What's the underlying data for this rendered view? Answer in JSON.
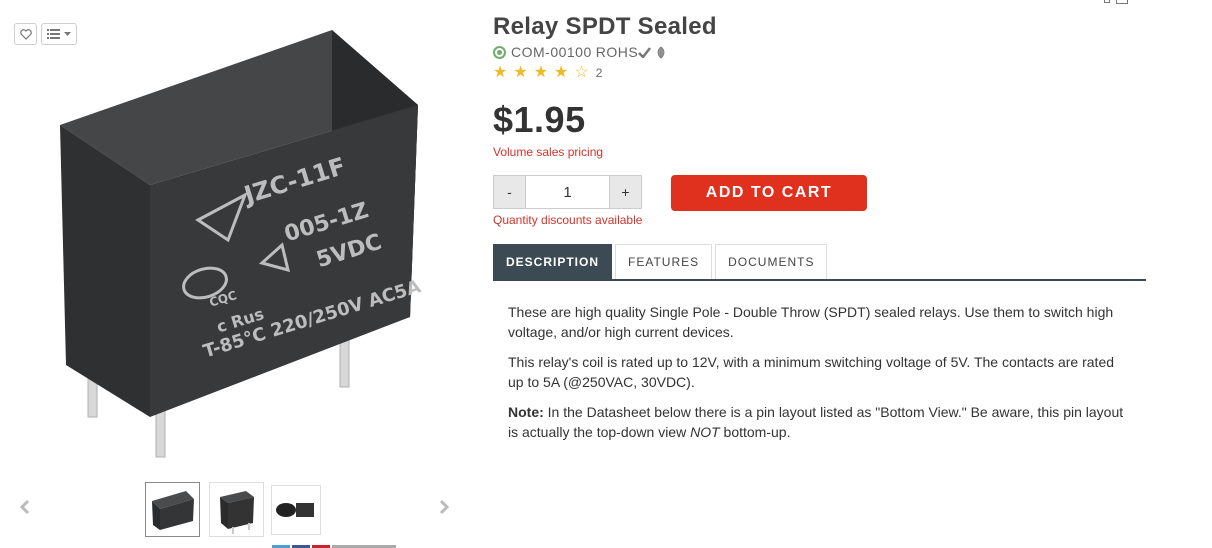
{
  "product": {
    "title": "Relay SPDT Sealed",
    "sku": "COM-00100",
    "rohs": "ROHS",
    "rating": 4,
    "rating_max": 5,
    "review_count": "2",
    "price": "$1.95",
    "volume_pricing": "Volume sales pricing",
    "quantity": "1",
    "qty_minus": "-",
    "qty_plus": "+",
    "quantity_discounts": "Quantity discounts available",
    "add_to_cart": "ADD TO CART"
  },
  "image": {
    "brand_text": "JZC-11F",
    "model_text": "005-1Z",
    "voltage_text": "5VDC",
    "rating_text": "T-85°C 220/250V AC5A",
    "cqc_text": "CQC",
    "ul_text": "c Rus"
  },
  "tabs": [
    {
      "label": "DESCRIPTION",
      "active": true
    },
    {
      "label": "FEATURES",
      "active": false
    },
    {
      "label": "DOCUMENTS",
      "active": false
    }
  ],
  "description": {
    "p1": "These are high quality Single Pole - Double Throw (SPDT) sealed relays. Use them to switch high voltage, and/or high current devices.",
    "p2": "This relay's coil is rated up to 12V, with a minimum switching voltage of 5V. The contacts are rated up to 5A (@250VAC, 30VDC).",
    "note_label": "Note:",
    "note_before": " In the Datasheet below there is a pin layout listed as \"Bottom View.\" Be aware, this pin layout is actually the top-down view ",
    "note_em": "NOT",
    "note_after": " bottom-up."
  },
  "icons": {
    "wishlist": "heart-icon",
    "list": "list-icon",
    "stock": "in-stock-icon",
    "rohs_check": "check-icon",
    "rohs_leaf": "leaf-icon"
  },
  "colors": {
    "accent_red": "#e0301e",
    "tab_active": "#3c4a53",
    "star": "#f0b928",
    "stock_green": "#6fae6a"
  }
}
